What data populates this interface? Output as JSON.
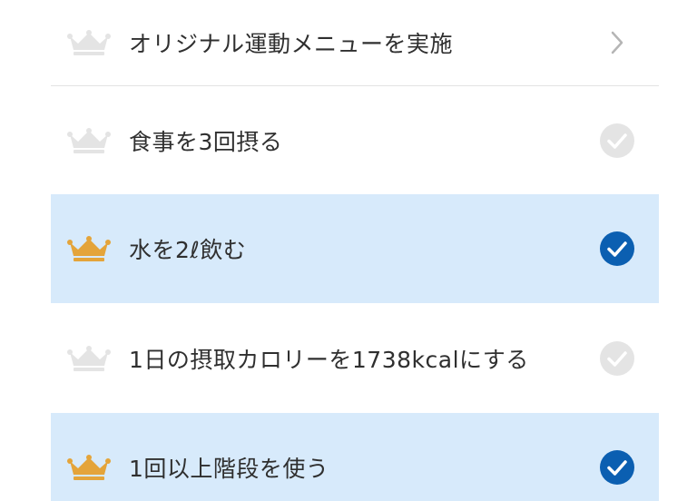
{
  "tasks": [
    {
      "label": "オリジナル運動メニューを実施",
      "status": "pending",
      "trailing_icon": "chevron-right-icon"
    },
    {
      "label": "食事を3回摂る",
      "status": "not-done",
      "trailing_icon": "check-circle-icon"
    },
    {
      "label": "水を2ℓ飲む",
      "status": "done",
      "trailing_icon": "check-circle-icon"
    },
    {
      "label": "1日の摂取カロリーを1738kcalにする",
      "status": "not-done",
      "trailing_icon": "check-circle-icon"
    },
    {
      "label": "1回以上階段を使う",
      "status": "done",
      "trailing_icon": "check-circle-icon"
    }
  ],
  "colors": {
    "crown_done": "#e4a43a",
    "crown_pending": "#e4e4e4",
    "check_done": "#0b5fb1",
    "check_pending": "#e4e4e4",
    "active_row_bg": "#d7eafb",
    "chevron": "#b5b5b5"
  }
}
